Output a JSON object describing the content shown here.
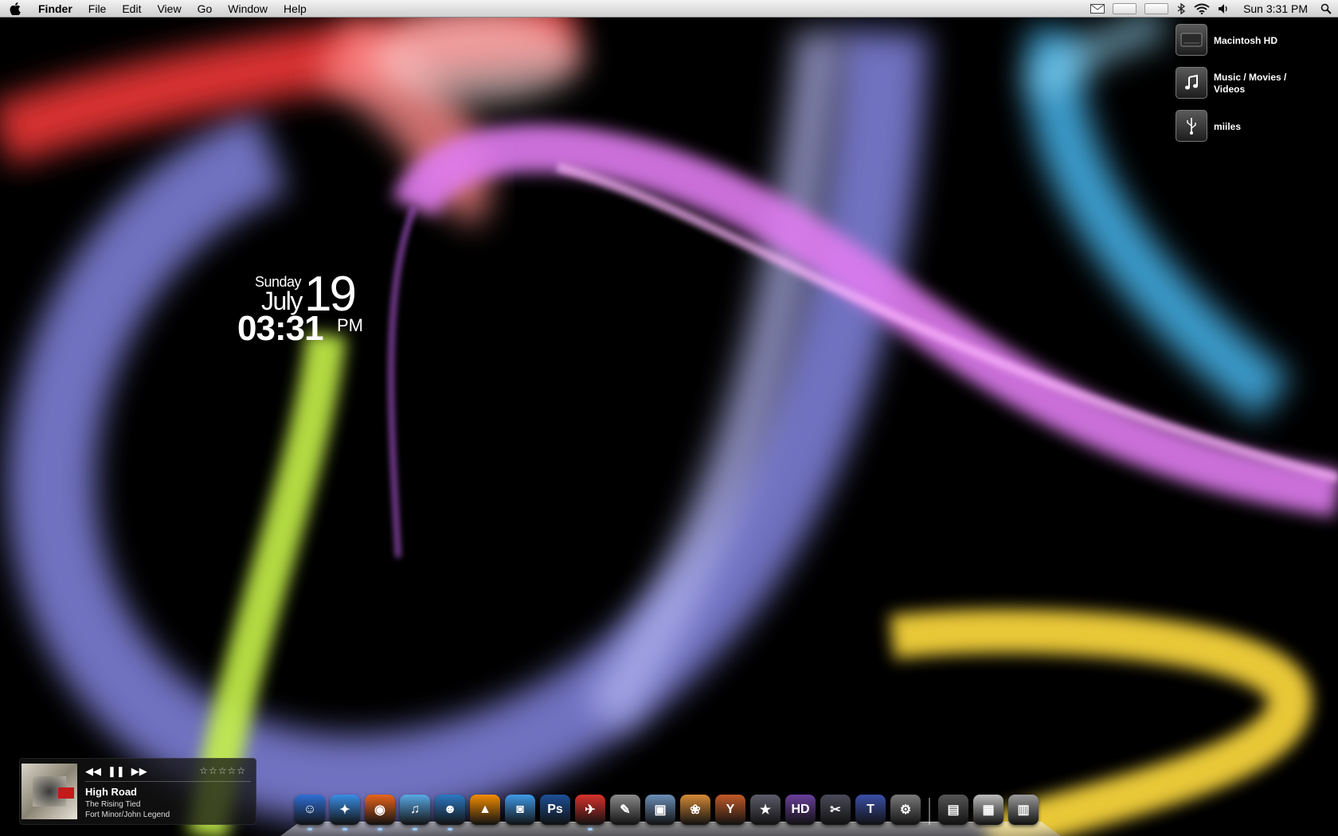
{
  "menubar": {
    "app_name": "Finder",
    "menus": [
      "File",
      "Edit",
      "View",
      "Go",
      "Window",
      "Help"
    ],
    "status_icons": [
      "mail-icon",
      "battery-meter-icon",
      "network-meter-icon",
      "bluetooth-icon",
      "wifi-icon",
      "volume-icon"
    ],
    "clock": "Sun 3:31 PM"
  },
  "date_widget": {
    "day": "Sunday",
    "month": "July",
    "date": "19",
    "time": "03:31",
    "ampm": "PM"
  },
  "desktop_icons": [
    {
      "label": "Macintosh HD",
      "icon": "hard-drive-icon"
    },
    {
      "label": "Music / Movies / Videos",
      "icon": "music-note-icon"
    },
    {
      "label": "miiles",
      "icon": "usb-drive-icon"
    }
  ],
  "now_playing": {
    "title": "High Road",
    "album": "The Rising Tied",
    "artist": "Fort Minor/John Legend",
    "controls": {
      "prev": "◀◀",
      "pause": "❚❚",
      "next": "▶▶"
    },
    "stars": "☆☆☆☆☆"
  },
  "dock": {
    "items": [
      {
        "name": "finder",
        "glyph": "☺",
        "color": "#2f6fd6",
        "running": true
      },
      {
        "name": "safari",
        "glyph": "✦",
        "color": "#3a8ee6",
        "running": true
      },
      {
        "name": "firefox",
        "glyph": "◉",
        "color": "#e8641c",
        "running": true
      },
      {
        "name": "itunes",
        "glyph": "♫",
        "color": "#5aa9e6",
        "running": true
      },
      {
        "name": "adium",
        "glyph": "☻",
        "color": "#2c79c4",
        "running": true
      },
      {
        "name": "vlc",
        "glyph": "▲",
        "color": "#f28c00",
        "running": false
      },
      {
        "name": "ichat",
        "glyph": "◙",
        "color": "#3f9ae8",
        "running": false
      },
      {
        "name": "photoshop",
        "glyph": "Ps",
        "color": "#1c4f96",
        "running": false
      },
      {
        "name": "transmit",
        "glyph": "✈",
        "color": "#d8322c",
        "running": true
      },
      {
        "name": "script-editor",
        "glyph": "✎",
        "color": "#8a8a8a",
        "running": false
      },
      {
        "name": "preview",
        "glyph": "▣",
        "color": "#6b8fb8",
        "running": false
      },
      {
        "name": "iphoto",
        "glyph": "❀",
        "color": "#d58a36",
        "running": false
      },
      {
        "name": "cocktail",
        "glyph": "Y",
        "color": "#c25a28",
        "running": false
      },
      {
        "name": "imovie",
        "glyph": "★",
        "color": "#5c5c6a",
        "running": false
      },
      {
        "name": "hd-video",
        "glyph": "HD",
        "color": "#6a3f9c",
        "running": false
      },
      {
        "name": "final-cut",
        "glyph": "✂",
        "color": "#4a4a58",
        "running": false
      },
      {
        "name": "textmate",
        "glyph": "T",
        "color": "#3b4fa8",
        "running": false
      },
      {
        "name": "system-preferences",
        "glyph": "⚙",
        "color": "#7a7a7a",
        "running": false
      },
      {
        "name": "applications-stack",
        "glyph": "▤",
        "color": "#555",
        "running": false
      },
      {
        "name": "documents-stack",
        "glyph": "▦",
        "color": "#bbb",
        "running": false
      },
      {
        "name": "trash",
        "glyph": "▥",
        "color": "#9a9a9a",
        "running": false
      }
    ]
  }
}
